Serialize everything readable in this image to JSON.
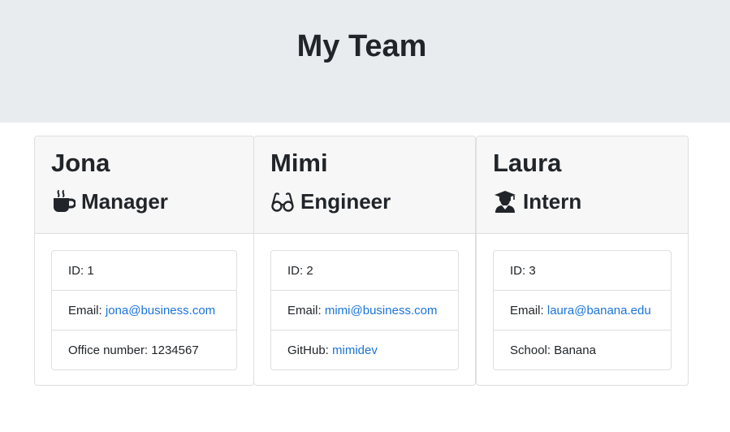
{
  "page": {
    "title": "My Team"
  },
  "employees": [
    {
      "name": "Jona",
      "role": "Manager",
      "icon": "coffee-mug-icon",
      "id_label": "ID: ",
      "id": "1",
      "email_label": "Email: ",
      "email": "jona@business.com",
      "extra_label": "Office number: ",
      "extra_value": "1234567"
    },
    {
      "name": "Mimi",
      "role": "Engineer",
      "icon": "glasses-icon",
      "id_label": "ID: ",
      "id": "2",
      "email_label": "Email: ",
      "email": "mimi@business.com",
      "extra_label": "GitHub: ",
      "extra_value": "mimidev"
    },
    {
      "name": "Laura",
      "role": "Intern",
      "icon": "graduate-icon",
      "id_label": "ID: ",
      "id": "3",
      "email_label": "Email: ",
      "email": "laura@banana.edu",
      "extra_label": "School: ",
      "extra_value": "Banana"
    }
  ],
  "colors": {
    "header_bg": "#e9ecef",
    "card_header_bg": "#f7f7f7",
    "link": "#1a73d9",
    "text": "#212529"
  }
}
